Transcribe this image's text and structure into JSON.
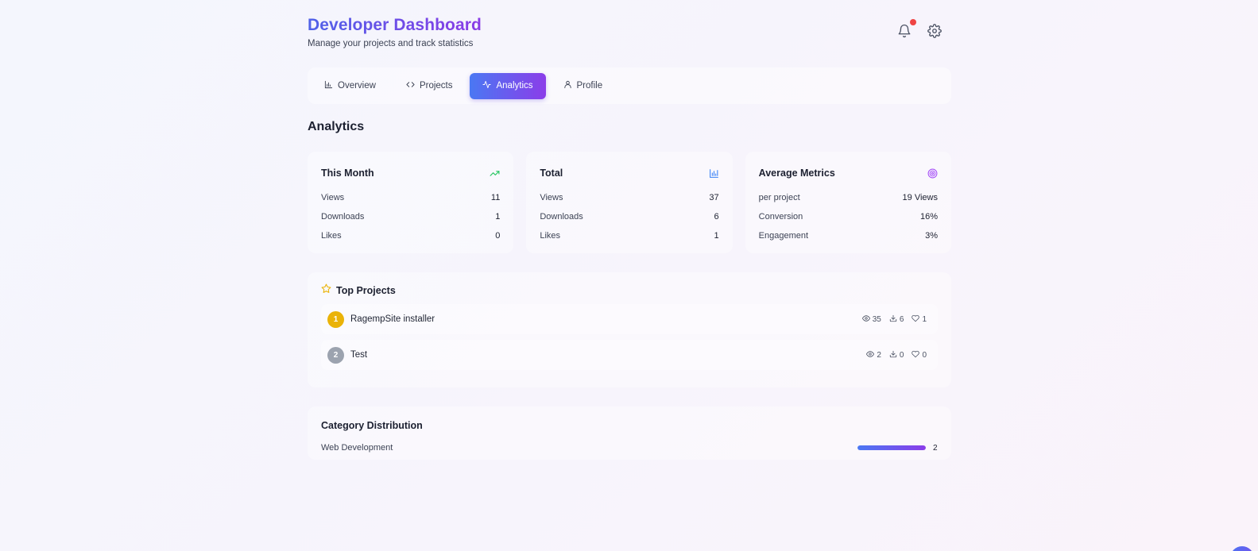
{
  "header": {
    "title": "Developer Dashboard",
    "subtitle": "Manage your projects and track statistics",
    "icons": [
      "bell-icon",
      "gear-icon"
    ],
    "notification_dot_color": "#ef4444"
  },
  "tabs": [
    {
      "label": "Overview",
      "icon": "bar-chart-icon",
      "active": false
    },
    {
      "label": "Projects",
      "icon": "code-icon",
      "active": false
    },
    {
      "label": "Analytics",
      "icon": "activity-icon",
      "active": true
    },
    {
      "label": "Profile",
      "icon": "user-icon",
      "active": false
    }
  ],
  "section_title": "Analytics",
  "cards": [
    {
      "title": "This Month",
      "icon": "trending-up-icon",
      "icon_color": "#22c55e",
      "rows": [
        {
          "label": "Views",
          "value": "11"
        },
        {
          "label": "Downloads",
          "value": "1"
        },
        {
          "label": "Likes",
          "value": "0"
        }
      ]
    },
    {
      "title": "Total",
      "icon": "bar-chart-icon",
      "icon_color": "#3b82f6",
      "rows": [
        {
          "label": "Views",
          "value": "37"
        },
        {
          "label": "Downloads",
          "value": "6"
        },
        {
          "label": "Likes",
          "value": "1"
        }
      ]
    },
    {
      "title": "Average Metrics",
      "icon": "target-icon",
      "icon_color": "#a855f7",
      "rows": [
        {
          "label": "per project",
          "value": "19 Views"
        },
        {
          "label": "Conversion",
          "value": "16%"
        },
        {
          "label": "Engagement",
          "value": "3%"
        }
      ]
    }
  ],
  "top_projects": {
    "title": "Top Projects",
    "icon": "star-icon",
    "items": [
      {
        "rank": "1",
        "rank_color": "#eab308",
        "name": "RagempSite installer",
        "views": "35",
        "downloads": "6",
        "likes": "1"
      },
      {
        "rank": "2",
        "rank_color": "#9ca3af",
        "name": "Test",
        "views": "2",
        "downloads": "0",
        "likes": "0"
      }
    ]
  },
  "category_distribution": {
    "title": "Category Distribution",
    "items": [
      {
        "name": "Web Development",
        "count": "2",
        "fill_fraction": 1.0
      }
    ]
  },
  "colors": {
    "accent_start": "#4a78f3",
    "accent_end": "#8b3de9"
  }
}
